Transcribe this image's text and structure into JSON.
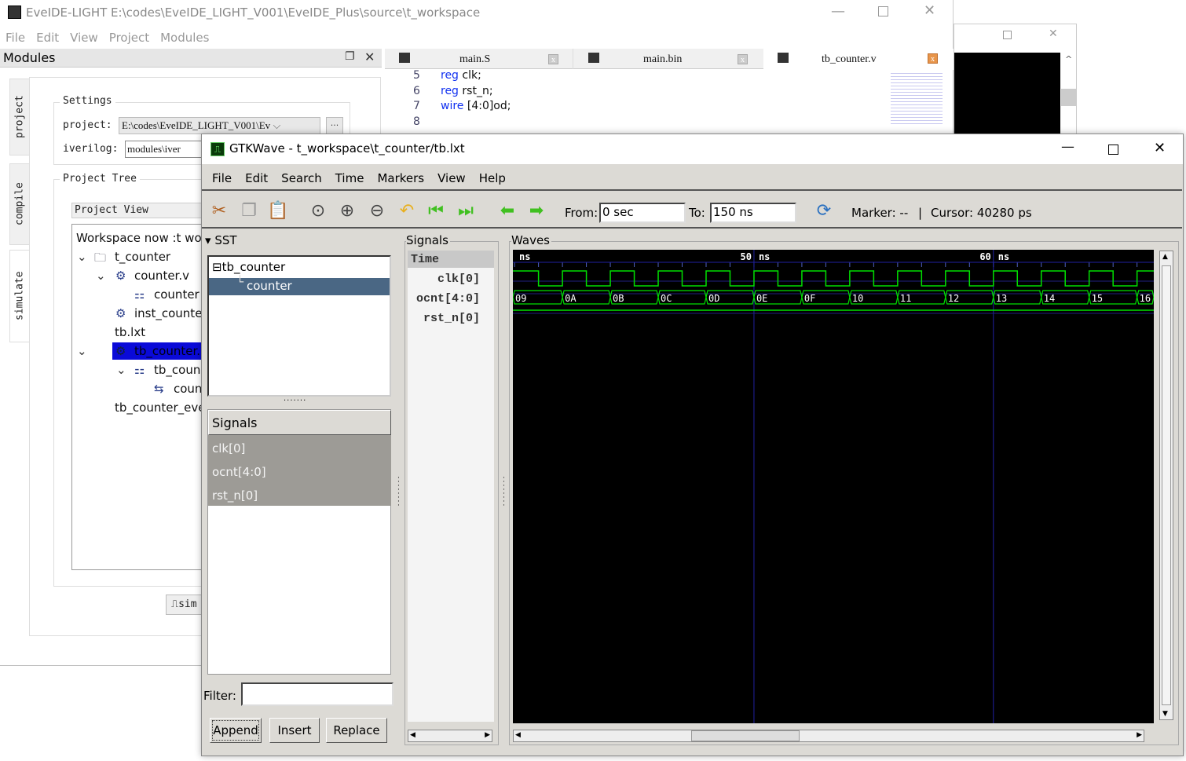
{
  "ide": {
    "title": "EveIDE-LIGHT  E:\\codes\\EveIDE_LIGHT_V001\\EveIDE_Plus\\source\\t_workspace",
    "menu": [
      "File",
      "Edit",
      "View",
      "Project",
      "Modules"
    ],
    "panel_title": "Modules",
    "side_tabs": [
      "project",
      "compile",
      "simulate"
    ],
    "settings_label": "Settings",
    "project_label": "project:",
    "project_value": "E:\\codes\\EveIDE_LIGHT_V001\\Ev",
    "browse_label": "···",
    "iverilog_label": "iverilog:",
    "iverilog_value": "modules\\iver",
    "project_tree_label": "Project Tree",
    "project_view_label": "Project View",
    "tree": [
      "Workspace now :t wo",
      "t_counter",
      "counter.v",
      "counter",
      "inst_counte",
      "tb.lxt",
      "tb_counter.",
      "tb_coun",
      "coun",
      "tb_counter_eve"
    ],
    "simulate_button": "sim",
    "editor_tabs": [
      {
        "label": "main.S"
      },
      {
        "label": "main.bin"
      },
      {
        "label": "tb_counter.v",
        "active": true
      }
    ],
    "code": [
      {
        "n": "5",
        "kw": "reg",
        "rest": " clk;"
      },
      {
        "n": "6",
        "kw": "reg",
        "rest": " rst_n;"
      },
      {
        "n": "7",
        "kw": "wire",
        "rest": " [4:0]od;"
      },
      {
        "n": "8",
        "kw": "",
        "rest": ""
      }
    ]
  },
  "gtkwave": {
    "title": "GTKWave - t_workspace\\t_counter/tb.lxt",
    "menu": [
      "File",
      "Edit",
      "Search",
      "Time",
      "Markers",
      "View",
      "Help"
    ],
    "from_label": "From:",
    "from_value": "0 sec",
    "to_label": "To:",
    "to_value": "150 ns",
    "marker_text": "Marker: --",
    "separator": "|",
    "cursor_text": "Cursor: 40280 ps",
    "sst_label": "SST",
    "sst_tree": [
      "tb_counter",
      "counter"
    ],
    "signals_header": "Signals",
    "signals_list": [
      "clk[0]",
      "ocnt[4:0]",
      "rst_n[0]"
    ],
    "filter_label": "Filter:",
    "filter_value": "",
    "buttons": [
      "Append",
      "Insert",
      "Replace"
    ],
    "signals_pane_label": "Signals",
    "time_label": "Time",
    "signal_names": [
      "clk[0]",
      "ocnt[4:0]",
      "rst_n[0]"
    ],
    "waves_label": "Waves",
    "timeline": {
      "unit_label": "ns",
      "major": [
        {
          "t": 50,
          "label": "50 ns"
        },
        {
          "t": 60,
          "label": "60 ns"
        }
      ],
      "view_start_ns": 39.93,
      "view_end_ns": 66.7
    },
    "clk": {
      "period_ns": 2,
      "first_rise_ns": 40
    },
    "ocnt": {
      "change_times_ns": [
        38,
        42,
        44,
        46,
        48,
        50,
        52,
        54,
        56,
        58,
        60,
        62,
        64,
        66
      ],
      "values": [
        "09",
        "0A",
        "0B",
        "0C",
        "0D",
        "0E",
        "0F",
        "10",
        "11",
        "12",
        "13",
        "14",
        "15",
        "16"
      ]
    },
    "rst_n": {
      "value": 1
    },
    "colors": {
      "wave": "#00e000",
      "grid": "#2020a0",
      "bg": "#000000",
      "selected": "#4a6784"
    }
  }
}
